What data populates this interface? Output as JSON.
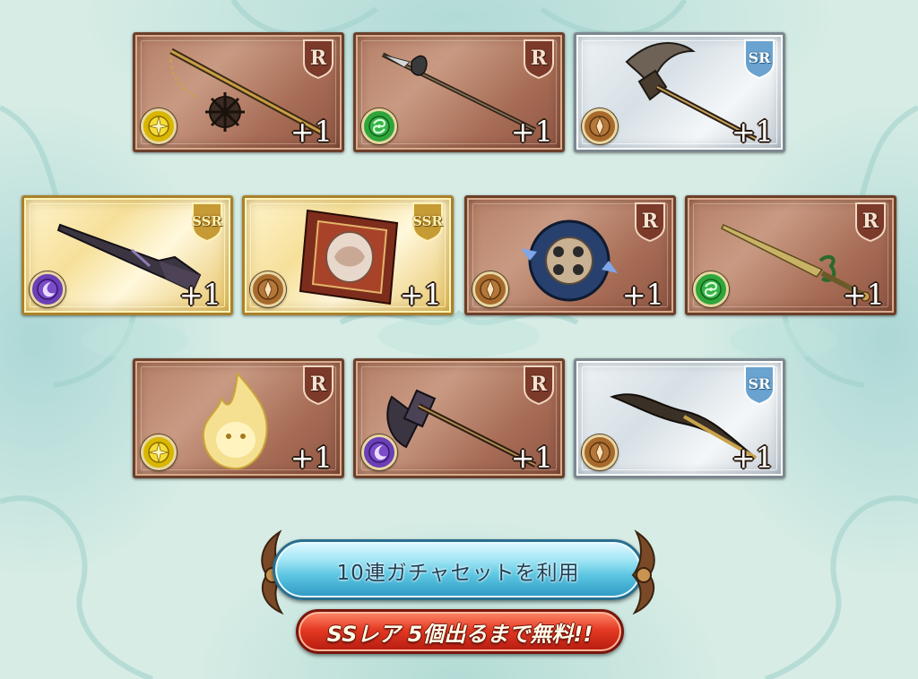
{
  "rows": [
    {
      "cards": [
        {
          "rarity": "r",
          "rarity_label": "R",
          "element": "light",
          "item": "flail-icon",
          "plus": "+1"
        },
        {
          "rarity": "r",
          "rarity_label": "R",
          "element": "wind",
          "item": "halberd-icon",
          "plus": "+1"
        },
        {
          "rarity": "sr",
          "rarity_label": "SR",
          "element": "earth",
          "item": "scythe-icon",
          "plus": "+1"
        }
      ]
    },
    {
      "cards": [
        {
          "rarity": "ssr",
          "rarity_label": "SSR",
          "element": "dark",
          "item": "musket-icon",
          "plus": "+1"
        },
        {
          "rarity": "ssr",
          "rarity_label": "SSR",
          "element": "earth",
          "item": "tome-icon",
          "plus": "+1"
        },
        {
          "rarity": "r",
          "rarity_label": "R",
          "element": "earth",
          "item": "chakram-icon",
          "plus": "+1"
        },
        {
          "rarity": "r",
          "rarity_label": "R",
          "element": "wind",
          "item": "dagger-icon",
          "plus": "+1"
        }
      ]
    },
    {
      "cards": [
        {
          "rarity": "r",
          "rarity_label": "R",
          "element": "light",
          "item": "flame-spirit-icon",
          "plus": "+1"
        },
        {
          "rarity": "r",
          "rarity_label": "R",
          "element": "dark",
          "item": "battle-axe-icon",
          "plus": "+1"
        },
        {
          "rarity": "sr",
          "rarity_label": "SR",
          "element": "earth",
          "item": "serpent-blade-icon",
          "plus": "+1"
        }
      ]
    }
  ],
  "colors": {
    "light": "#d9b600",
    "wind": "#2fa63a",
    "earth": "#a86a2c",
    "dark": "#6b3fb5"
  },
  "gacha_button": {
    "label": "10連ガチャセットを利用",
    "promo": "SSレア 5個出るまで無料!!"
  }
}
